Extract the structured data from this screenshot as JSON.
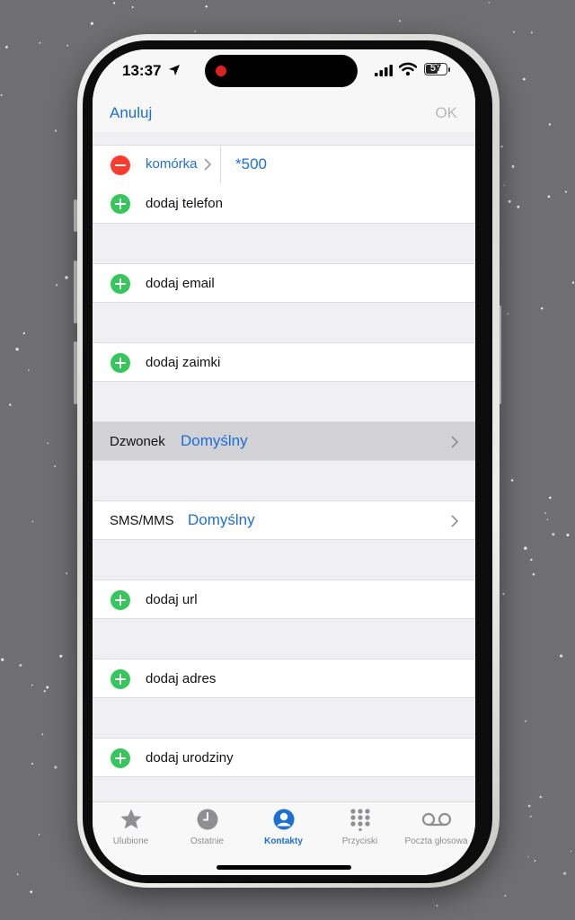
{
  "status_bar": {
    "time": "13:37",
    "battery": "57"
  },
  "nav": {
    "cancel_label": "Anuluj",
    "ok_label": "OK"
  },
  "phone_entry": {
    "type_label": "komórka",
    "number": "*500"
  },
  "add_rows": {
    "phone": "dodaj telefon",
    "email": "dodaj email",
    "pronouns": "dodaj zaimki",
    "url": "dodaj url",
    "address": "dodaj adres",
    "birthday": "dodaj urodziny"
  },
  "ringtone": {
    "label": "Dzwonek",
    "value": "Domyślny"
  },
  "text_tone": {
    "label": "SMS/MMS",
    "value": "Domyślny"
  },
  "tabs": [
    {
      "label": "Ulubione",
      "icon": "star-icon"
    },
    {
      "label": "Ostatnie",
      "icon": "clock-icon"
    },
    {
      "label": "Kontakty",
      "icon": "person-circle-icon",
      "active": true
    },
    {
      "label": "Przyciski",
      "icon": "keypad-icon"
    },
    {
      "label": "Poczta głosowa",
      "icon": "voicemail-icon"
    }
  ],
  "colors": {
    "accent": "#1d6fd6",
    "add_green": "#34c759",
    "remove_red": "#ff3b30",
    "grouped_background": "#efeff4",
    "highlighted_row": "#d1d1d6"
  }
}
